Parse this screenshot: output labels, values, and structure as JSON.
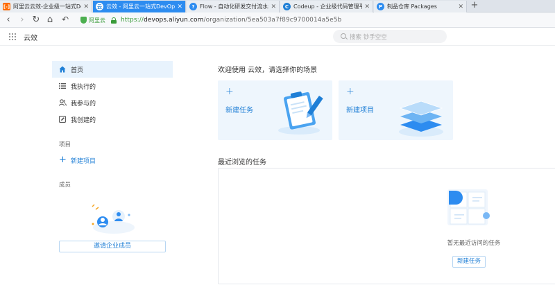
{
  "browser": {
    "tabs": [
      {
        "title": "阿里云云效-企业级一站式DevO",
        "favicon": "aliyun-orange-icon",
        "color": "#ff6a00",
        "active": false
      },
      {
        "title": "云效 - 阿里云一站式DevOps平",
        "favicon": "yunxiao-icon",
        "color": "#1f7fd6",
        "active": true
      },
      {
        "title": "Flow - 自动化研发交付流水线_",
        "favicon": "flow-icon",
        "color": "#2d8cf0",
        "active": false
      },
      {
        "title": "Codeup - 企业级代码管理平台",
        "favicon": "codeup-icon",
        "color": "#1f7fd6",
        "active": false
      },
      {
        "title": "制品仓库 Packages",
        "favicon": "packages-icon",
        "color": "#2d8cf0",
        "active": false
      }
    ],
    "new_tab_label": "+",
    "site_badge": "阿里云",
    "url_scheme": "https://",
    "url_host": "devops.aliyun.com",
    "url_path": "/organization/5ea503a7f89c9700014a5e5b"
  },
  "header": {
    "app_name": "云效",
    "search_placeholder": "搜索 钞手空空"
  },
  "sidebar": {
    "items": [
      {
        "label": "首页",
        "icon": "home-icon",
        "active": true
      },
      {
        "label": "我执行的",
        "icon": "list-icon",
        "active": false
      },
      {
        "label": "我参与的",
        "icon": "users-icon",
        "active": false
      },
      {
        "label": "我创建的",
        "icon": "edit-doc-icon",
        "active": false
      }
    ],
    "projects_title": "项目",
    "new_project_label": "新建项目",
    "members_title": "成员",
    "invite_label": "邀请企业成员"
  },
  "main": {
    "welcome_text": "欢迎使用 云效，请选择你的场景",
    "cards": [
      {
        "label": "新建任务",
        "icon": "clipboard-pencil-icon"
      },
      {
        "label": "新建项目",
        "icon": "layers-icon"
      }
    ],
    "recent_title": "最近浏览的任务",
    "empty_text": "暂无最近访问的任务",
    "new_task_label": "新建任务"
  },
  "colors": {
    "accent": "#1f7fd6",
    "active_tab": "#2d8cf0",
    "card_bg": "#eef6fd",
    "sidebar_active_bg": "#e8f3fd"
  }
}
